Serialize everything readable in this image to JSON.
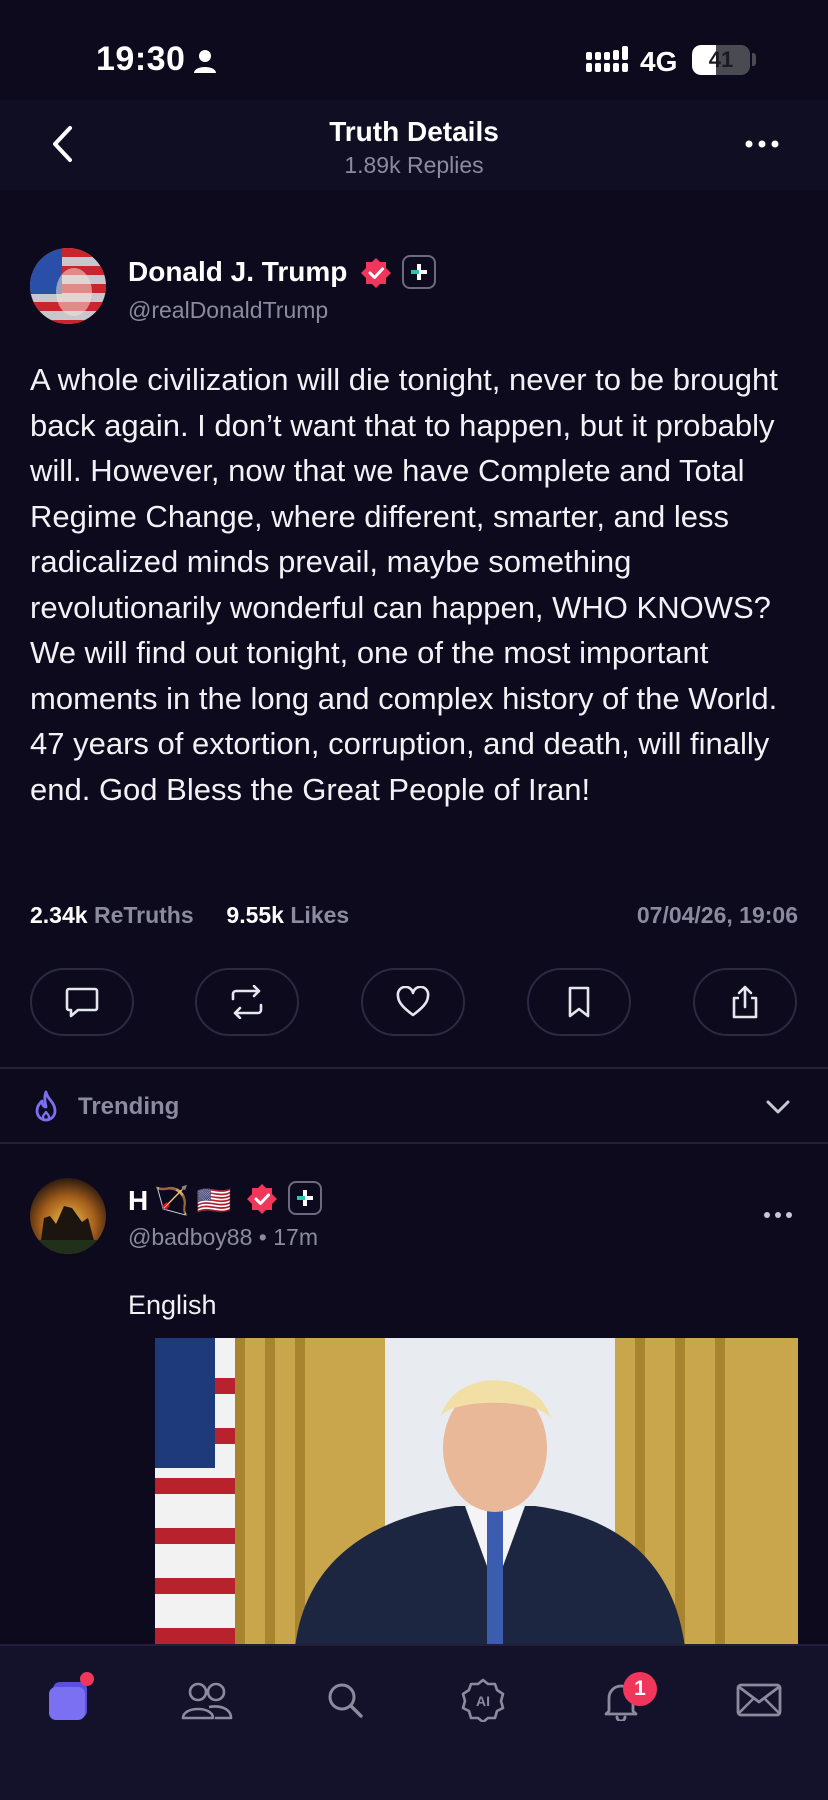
{
  "status_bar": {
    "time": "19:30",
    "network": "4G",
    "battery": "41",
    "battery_level": 0.41
  },
  "header": {
    "title": "Truth Details",
    "subtitle": "1.89k Replies"
  },
  "post": {
    "author_name": "Donald J. Trump",
    "handle": "@realDonaldTrump",
    "text": "A whole civilization will die tonight, never to be brought back again. I don’t want that to happen, but it probably will. However, now that we have Complete and Total Regime Change, where different, smarter, and less radicalized minds prevail, maybe something revolutionarily wonderful can happen, WHO KNOWS? We will find out tonight, one of the most important moments in the long and complex history of the World. 47 years of extortion, corruption, and death, will finally end. God Bless the Great People of Iran!",
    "retruths_count": "2.34k",
    "retruths_label": "ReTruths",
    "likes_count": "9.55k",
    "likes_label": "Likes",
    "timestamp": "07/04/26, 19:06"
  },
  "actions": [
    "reply-icon",
    "retruth-icon",
    "heart-icon",
    "bookmark-icon",
    "share-icon"
  ],
  "trending": {
    "label": "Trending"
  },
  "reply": {
    "name": "H",
    "emoji": "🏹 🇺🇸",
    "handle": "@badboy88",
    "separator": "•",
    "age": "17m",
    "text": "English"
  },
  "tab_bar": {
    "items": [
      "home-icon",
      "groups-icon",
      "search-icon",
      "ai-icon",
      "notifications-icon",
      "messages-icon"
    ],
    "notification_count": "1"
  },
  "colors": {
    "background": "#0c0a1c",
    "accent": "#7b6ff2",
    "verified": "#f0365a",
    "muted": "#8c8a9e"
  }
}
